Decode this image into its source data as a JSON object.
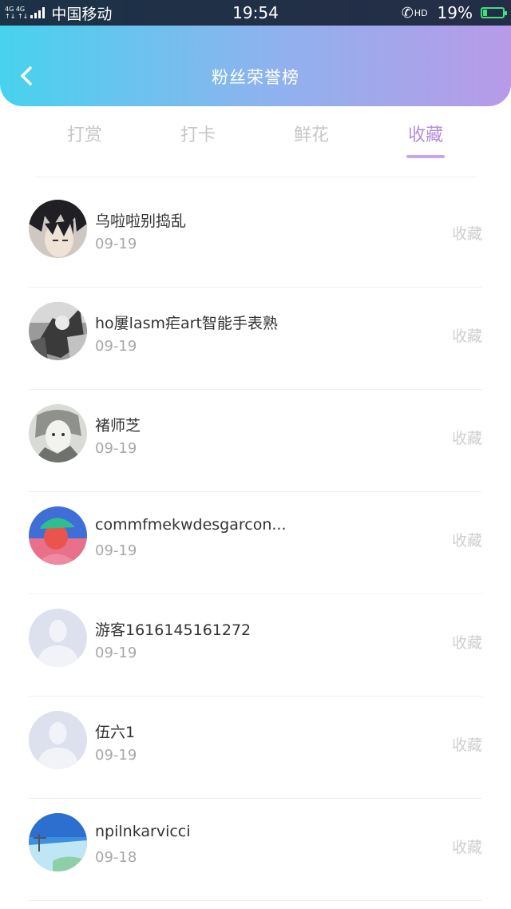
{
  "status_bar": {
    "network_top": "4G 4G",
    "network_bottom": "↑↓ ↑↓",
    "carrier": "中国移动",
    "time": "19:54",
    "hd": "HD",
    "battery": "19%",
    "battery_level": 0.19,
    "battery_color": "#3fe07a"
  },
  "header": {
    "title": "粉丝荣誉榜",
    "back_icon": "chevron-left-icon",
    "gradient": [
      "#47d2ee",
      "#b89ae8"
    ]
  },
  "tabs": [
    {
      "label": "打赏",
      "active": false
    },
    {
      "label": "打卡",
      "active": false
    },
    {
      "label": "鲜花",
      "active": false
    },
    {
      "label": "收藏",
      "active": true
    }
  ],
  "accent_color": "#b48ddd",
  "fans": [
    {
      "name": "乌啦啦别捣乱",
      "date": "09-19",
      "action": "收藏",
      "avatar": "avatar-anime"
    },
    {
      "name": "ho屢lasm疟art智能手表熟",
      "date": "09-19",
      "action": "收藏",
      "avatar": "avatar-bw-photo"
    },
    {
      "name": "褚师芝",
      "date": "09-19",
      "action": "收藏",
      "avatar": "avatar-sketch"
    },
    {
      "name": "commfmekwdesgarcon...",
      "date": "09-19",
      "action": "收藏",
      "avatar": "avatar-cap-person"
    },
    {
      "name": "游客1616145161272",
      "date": "09-19",
      "action": "收藏",
      "avatar": "avatar-default"
    },
    {
      "name": "伍六1",
      "date": "09-19",
      "action": "收藏",
      "avatar": "avatar-default"
    },
    {
      "name": "npilnkarvicci",
      "date": "09-18",
      "action": "收藏",
      "avatar": "avatar-sky"
    }
  ]
}
